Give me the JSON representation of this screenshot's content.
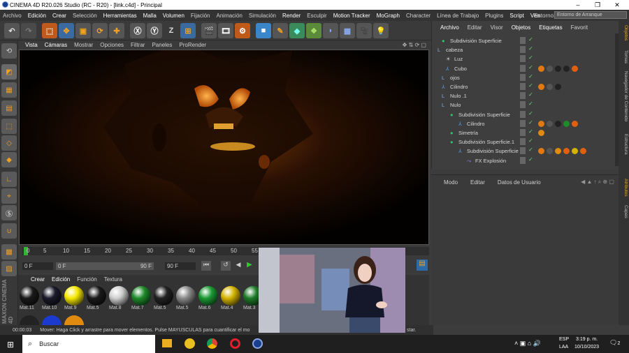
{
  "window": {
    "title": "CINEMA 4D R20.026 Studio (RC - R20) - [link.c4d] - Principal",
    "minimize": "–",
    "restore": "❐",
    "close": "✕"
  },
  "menubar": {
    "items": [
      "Archivo",
      "Edición",
      "Crear",
      "Selección",
      "Herramientas",
      "Malla",
      "Volumen",
      "Fijación",
      "Animación",
      "Simulación",
      "Render",
      "Esculpir",
      "Motion Tracker",
      "MoGraph",
      "Character",
      "Línea de Trabajo",
      "Plugins",
      "Script",
      "Ventana"
    ],
    "environment_label": "Entorno:",
    "environment_value": "Entorno de Arranque"
  },
  "toolbar": {
    "buttons": [
      "undo",
      "redo",
      "live-selection",
      "move",
      "scale",
      "rotate",
      "add-object",
      "x-axis",
      "y-axis",
      "z-axis",
      "world-coords",
      "render-view",
      "render-picture-viewer",
      "render-settings",
      "cube",
      "pen",
      "subdivision",
      "cloner",
      "deformer",
      "floor",
      "camera",
      "light"
    ]
  },
  "viewport": {
    "menu": [
      "Vista",
      "Cámaras",
      "Mostrar",
      "Opciones",
      "Filtrar",
      "Paneles",
      "ProRender"
    ]
  },
  "timeline": {
    "ticks": [
      "0",
      "5",
      "10",
      "15",
      "20",
      "25",
      "30",
      "35",
      "40",
      "45",
      "50",
      "55"
    ],
    "frame_start": "0 F",
    "frame_current": "0 F",
    "frame_end": "90 F",
    "frame_end2": "90 F"
  },
  "materials": {
    "menu": [
      "Crear",
      "Edición",
      "Función",
      "Textura"
    ],
    "items": [
      {
        "name": "Mat.11",
        "color": "#1a1a1a"
      },
      {
        "name": "Mat.10",
        "color": "#1a1a2a"
      },
      {
        "name": "Mat.9",
        "color": "#f5e800"
      },
      {
        "name": "Mat.5",
        "color": "#1a1a1a"
      },
      {
        "name": "Mat.8",
        "color": "#cfcfcf"
      },
      {
        "name": "Mat.7",
        "color": "#1e8a2a"
      },
      {
        "name": "Mat.5",
        "color": "#222222"
      },
      {
        "name": "Mat.5",
        "color": "#8a8a8a"
      },
      {
        "name": "Mat.6",
        "color": "#1c9a34"
      },
      {
        "name": "Mat.4",
        "color": "#d4b400"
      },
      {
        "name": "Mat.3",
        "color": "#1d7a28"
      }
    ]
  },
  "statusbar": {
    "time": "00:00:03",
    "message": "Mover: Haga Click y arrastre para mover elementos. Pulse MAYUSCULAS para cuantificar el mo",
    "tail": "star."
  },
  "objects": {
    "menu": [
      "Archivo",
      "Editar",
      "Visor",
      "Objetos",
      "Etiquetas",
      "Favorit"
    ],
    "rows": [
      {
        "name": "Subdivisión Superficie",
        "indent": 6,
        "icon": "green"
      },
      {
        "name": "cabeza",
        "indent": 0,
        "icon": "null"
      },
      {
        "name": "Luz",
        "indent": 12,
        "icon": "light"
      },
      {
        "name": "Cubo",
        "indent": 12,
        "icon": "blue"
      },
      {
        "name": "ojos",
        "indent": 6,
        "icon": "null"
      },
      {
        "name": "Cilindro",
        "indent": 6,
        "icon": "blue"
      },
      {
        "name": "Nulo .1",
        "indent": 6,
        "icon": "null"
      },
      {
        "name": "Nulo",
        "indent": 6,
        "icon": "null"
      },
      {
        "name": "Subdivisión Superficie",
        "indent": 18,
        "icon": "green"
      },
      {
        "name": "Cilindro",
        "indent": 30,
        "icon": "blue"
      },
      {
        "name": "Simetría",
        "indent": 18,
        "icon": "green"
      },
      {
        "name": "Subdivisión Superficie.1",
        "indent": 18,
        "icon": "green"
      },
      {
        "name": "Subdivisión Superficie",
        "indent": 30,
        "icon": "blue"
      },
      {
        "name": "FX Explosión",
        "indent": 42,
        "icon": "fx"
      }
    ]
  },
  "attributes": {
    "menu": [
      "Modo",
      "Editar",
      "Datos de Usuario"
    ]
  },
  "sidetabs": [
    "Objetos",
    "Tomas",
    "Navegador de Contenido",
    "Estructura",
    "Atributos",
    "Capas"
  ],
  "taskbar": {
    "search": "Buscar",
    "lang": "ESP",
    "lang2": "LAA",
    "time": "3:19 p. m.",
    "date": "10/10/2023",
    "notifications": "2"
  }
}
